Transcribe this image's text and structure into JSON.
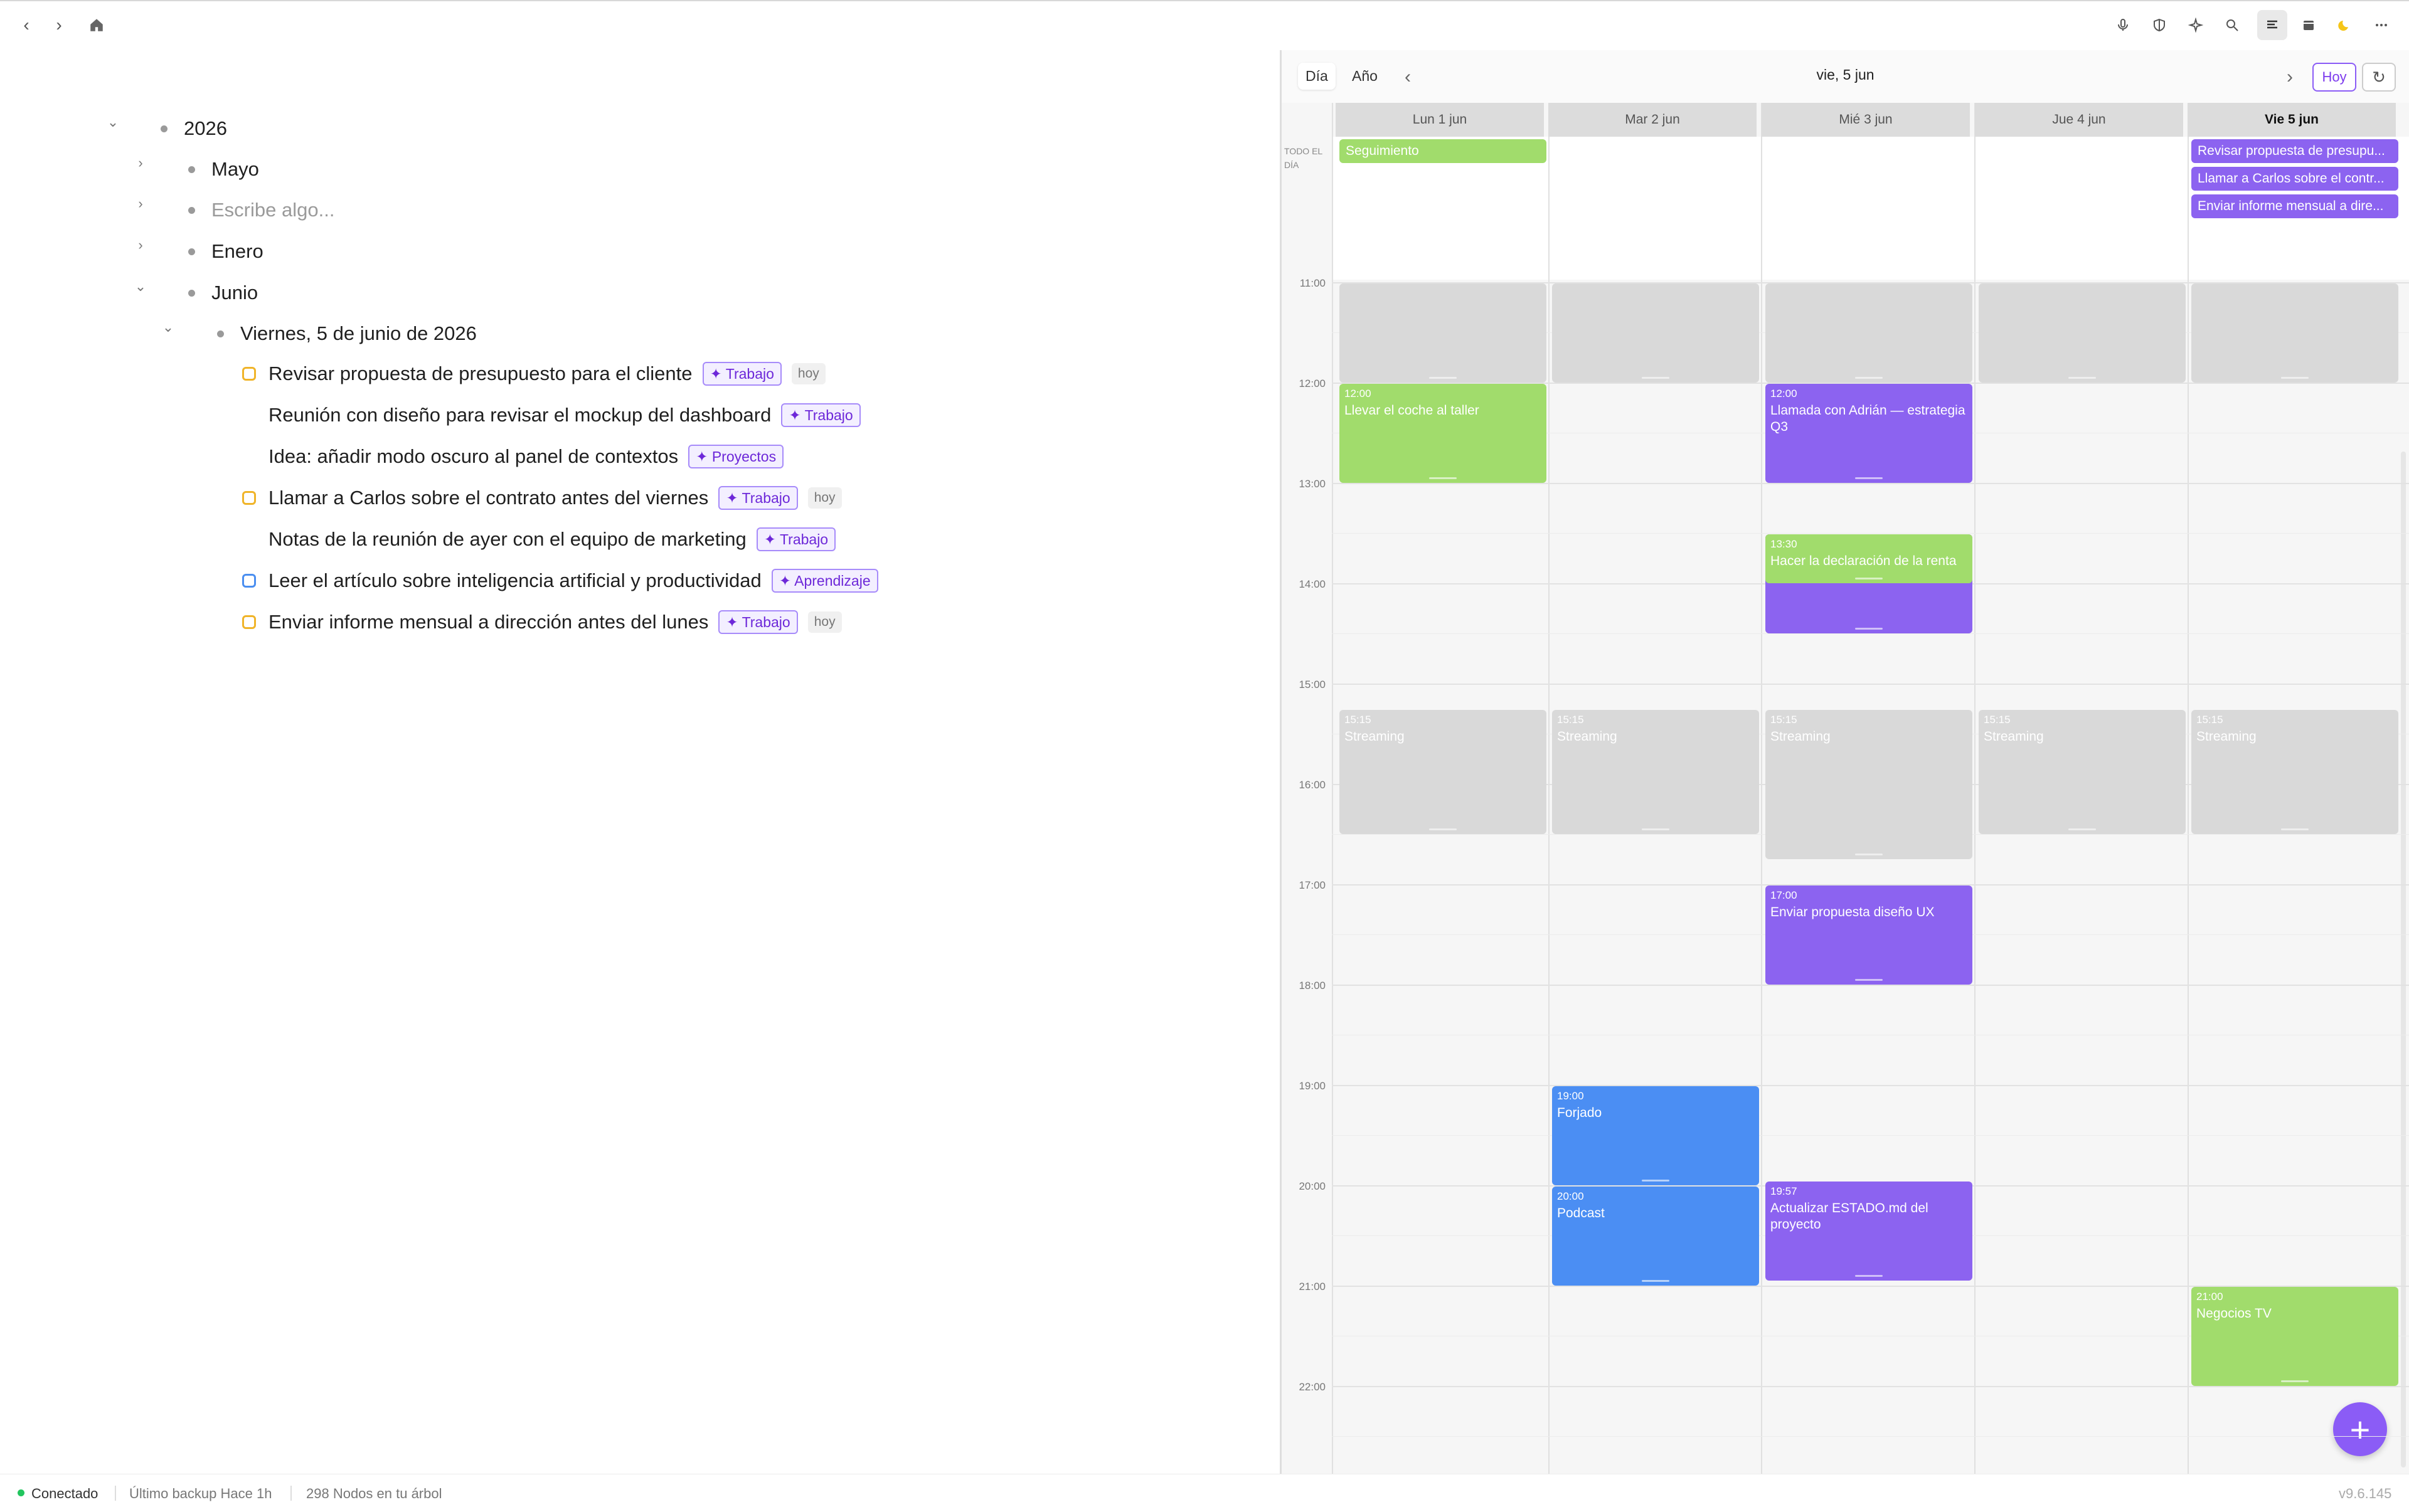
{
  "toolbar": {
    "back_icon": "‹",
    "forward_icon": "›",
    "home_icon": "⌂",
    "right_icons": [
      "mic-icon",
      "shield-icon",
      "sparkle-icon",
      "search-icon",
      "align-icon",
      "calendar-icon",
      "moon-icon",
      "more-icon"
    ]
  },
  "outline": {
    "root": "2026",
    "items": [
      {
        "label": "Mayo"
      },
      {
        "label": "Escribe algo..."
      },
      {
        "label": "Enero"
      },
      {
        "label": "Junio"
      }
    ],
    "day": "Viernes, 5 de junio de 2026",
    "tasks": [
      {
        "text": "Revisar propuesta de presupuesto para el cliente",
        "tag": "✦ Trabajo",
        "badge": "hoy",
        "checkbox": "yellow"
      },
      {
        "text": "Reunión con diseño para revisar el mockup del dashboard",
        "tag": "✦ Trabajo",
        "badge": "",
        "checkbox": ""
      },
      {
        "text": "Idea: añadir modo oscuro al panel de contextos",
        "tag": "✦ Proyectos",
        "badge": "",
        "checkbox": ""
      },
      {
        "text": "Llamar a Carlos sobre el contrato antes del viernes",
        "tag": "✦ Trabajo",
        "badge": "hoy",
        "checkbox": "yellow"
      },
      {
        "text": "Notas de la reunión de ayer con el equipo de marketing",
        "tag": "✦ Trabajo",
        "badge": "",
        "checkbox": ""
      },
      {
        "text": "Leer el artículo sobre inteligencia artificial y productividad",
        "tag": "✦ Aprendizaje",
        "badge": "",
        "checkbox": "blue"
      },
      {
        "text": "Enviar informe mensual a dirección antes del lunes",
        "tag": "✦ Trabajo",
        "badge": "hoy",
        "checkbox": "yellow"
      }
    ]
  },
  "calendar": {
    "view_day": "Día",
    "view_year": "Año",
    "title": "vie, 5 jun",
    "today_button": "Hoy",
    "prev_icon": "‹",
    "next_icon": "›",
    "refresh_icon": "↻",
    "allday_label": "TODO EL DÍA",
    "days": [
      "Lun 1 jun",
      "Mar 2 jun",
      "Mié 3 jun",
      "Jue 4 jun",
      "Vie 5 jun"
    ],
    "today_index": 4,
    "hours": [
      "11:00",
      "12:00",
      "13:00",
      "14:00",
      "15:00",
      "16:00",
      "17:00",
      "18:00",
      "19:00",
      "20:00",
      "21:00",
      "22:00"
    ],
    "allday_events": [
      {
        "day": 0,
        "title": "Seguimiento",
        "color": "#a1dc6c",
        "slot": 0
      },
      {
        "day": 4,
        "title": "Revisar propuesta de presupu...",
        "color": "#8c63f0",
        "slot": 0
      },
      {
        "day": 4,
        "title": "Llamar a Carlos sobre el contr...",
        "color": "#8c63f0",
        "slot": 1
      },
      {
        "day": 4,
        "title": "Enviar informe mensual a dire...",
        "color": "#8c63f0",
        "slot": 2
      }
    ],
    "events": [
      {
        "day": 0,
        "start": "11:00",
        "end": "12:00",
        "time": "",
        "title": "",
        "kind": "grey"
      },
      {
        "day": 1,
        "start": "11:00",
        "end": "12:00",
        "time": "",
        "title": "",
        "kind": "grey"
      },
      {
        "day": 2,
        "start": "11:00",
        "end": "12:00",
        "time": "",
        "title": "",
        "kind": "grey"
      },
      {
        "day": 3,
        "start": "11:00",
        "end": "12:00",
        "time": "",
        "title": "",
        "kind": "grey"
      },
      {
        "day": 4,
        "start": "11:00",
        "end": "12:00",
        "time": "",
        "title": "",
        "kind": "grey"
      },
      {
        "day": 0,
        "start": "12:00",
        "end": "13:00",
        "time": "12:00",
        "title": "Llevar el coche al taller",
        "kind": "green"
      },
      {
        "day": 2,
        "start": "12:00",
        "end": "13:00",
        "time": "12:00",
        "title": "Llamada con Adrián — estrategia Q3",
        "kind": "purple"
      },
      {
        "day": 2,
        "start": "13:30",
        "end": "14:30",
        "time": "",
        "title": "",
        "kind": "purple"
      },
      {
        "day": 2,
        "start": "13:30",
        "end": "14:00",
        "time": "13:30",
        "title": "Hacer la declaración de la renta",
        "kind": "green"
      },
      {
        "day": 0,
        "start": "15:15",
        "end": "16:30",
        "time": "15:15",
        "title": "Streaming",
        "kind": "grey"
      },
      {
        "day": 1,
        "start": "15:15",
        "end": "16:30",
        "time": "15:15",
        "title": "Streaming",
        "kind": "grey"
      },
      {
        "day": 2,
        "start": "15:15",
        "end": "16:45",
        "time": "15:15",
        "title": "Streaming",
        "kind": "grey"
      },
      {
        "day": 3,
        "start": "15:15",
        "end": "16:30",
        "time": "15:15",
        "title": "Streaming",
        "kind": "grey"
      },
      {
        "day": 4,
        "start": "15:15",
        "end": "16:30",
        "time": "15:15",
        "title": "Streaming",
        "kind": "grey"
      },
      {
        "day": 2,
        "start": "17:00",
        "end": "18:00",
        "time": "17:00",
        "title": "Enviar propuesta diseño UX",
        "kind": "purple"
      },
      {
        "day": 1,
        "start": "19:00",
        "end": "20:00",
        "time": "19:00",
        "title": "Forjado",
        "kind": "blue"
      },
      {
        "day": 1,
        "start": "20:00",
        "end": "21:00",
        "time": "20:00",
        "title": "Podcast",
        "kind": "blue"
      },
      {
        "day": 2,
        "start": "19:57",
        "end": "20:57",
        "time": "19:57",
        "title": "Actualizar ESTADO.md del proyecto",
        "kind": "purple"
      },
      {
        "day": 4,
        "start": "21:00",
        "end": "22:00",
        "time": "21:00",
        "title": "Negocios TV",
        "kind": "green"
      }
    ],
    "fab_label": "+"
  },
  "status": {
    "connected": "Conectado",
    "backup": "Último backup Hace 1h",
    "nodes": "298 Nodos en tu árbol",
    "version": "v9.6.145"
  }
}
